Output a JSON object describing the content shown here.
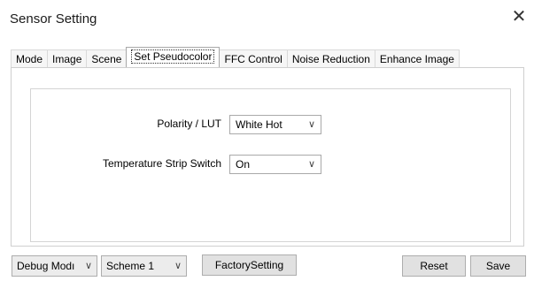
{
  "window": {
    "title": "Sensor Setting",
    "close_glyph": "✕"
  },
  "tabs": [
    {
      "label": "Mode"
    },
    {
      "label": "Image"
    },
    {
      "label": "Scene"
    },
    {
      "label": "Set Pseudocolor",
      "active": true
    },
    {
      "label": "FFC Control"
    },
    {
      "label": "Noise Reduction"
    },
    {
      "label": "Enhance Image"
    }
  ],
  "settings": {
    "polarity_label": "Polarity / LUT",
    "polarity_value": "White Hot",
    "strip_label": "Temperature Strip Switch",
    "strip_value": "On"
  },
  "footer": {
    "debug_mode_value": "Debug Modı",
    "scheme_value": "Scheme 1",
    "factory_setting": "FactorySetting",
    "reset": "Reset",
    "save": "Save"
  },
  "icons": {
    "chevron": "chevron-down-icon",
    "close": "close-icon"
  }
}
